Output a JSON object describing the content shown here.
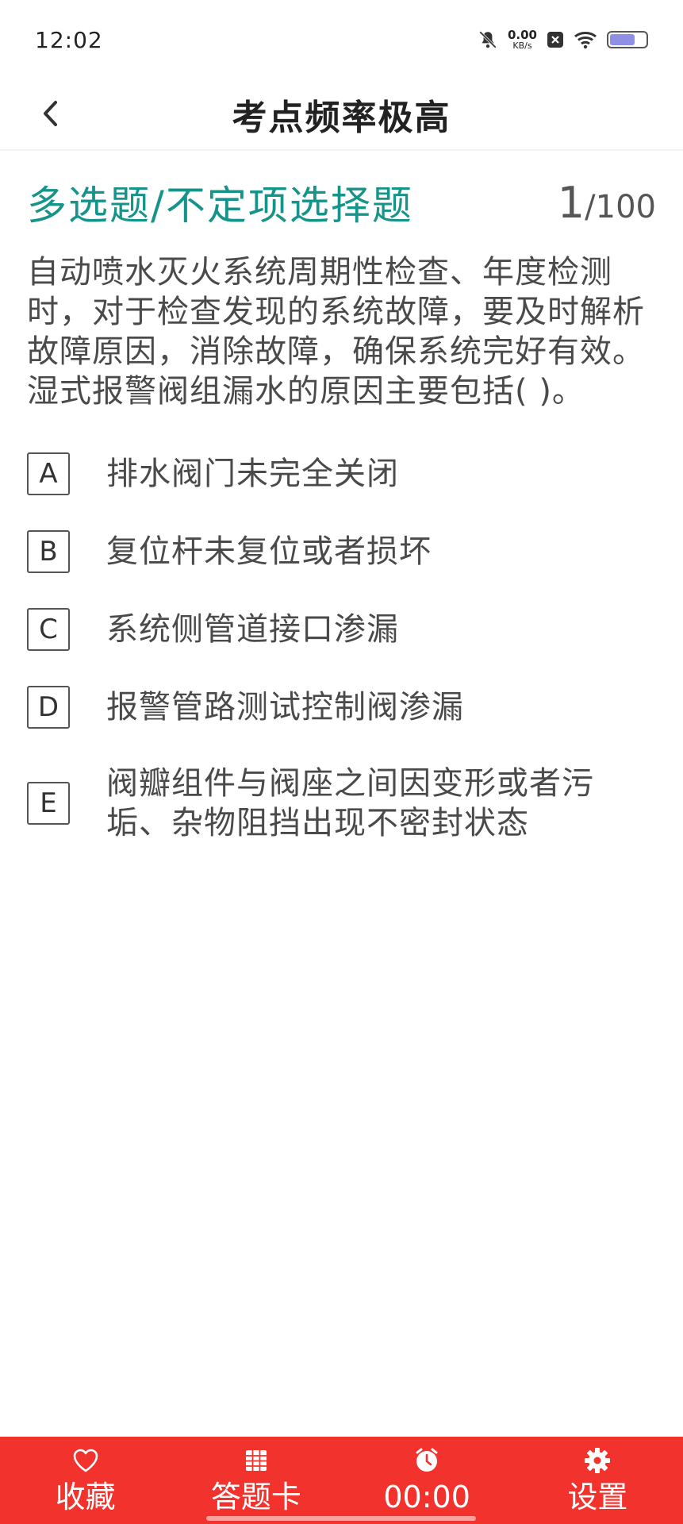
{
  "status_bar": {
    "time": "12:02",
    "net_speed_value": "0.00",
    "net_speed_unit": "KB/s",
    "icons": [
      "mute-bell-icon",
      "sim-x-icon",
      "wifi-icon",
      "battery-icon"
    ],
    "battery_level": 0.7
  },
  "header": {
    "title": "考点频率极高",
    "back_icon": "chevron-left-icon"
  },
  "question": {
    "type": "多选题/不定项选择题",
    "current": "1",
    "separator": "/",
    "total": "100",
    "stem": "自动喷水灭火系统周期性检查、年度检测时，对于检查发现的系统故障，要及时解析故障原因，消除故障，确保系统完好有效。湿式报警阀组漏水的原因主要包括( )。",
    "options": [
      {
        "key": "A",
        "text": "排水阀门未完全关闭"
      },
      {
        "key": "B",
        "text": "复位杆未复位或者损坏"
      },
      {
        "key": "C",
        "text": "系统侧管道接口渗漏"
      },
      {
        "key": "D",
        "text": "报警管路测试控制阀渗漏"
      },
      {
        "key": "E",
        "text": "阀瓣组件与阀座之间因变形或者污垢、杂物阻挡出现不密封状态"
      }
    ]
  },
  "bottom_bar": {
    "background": "#f2322d",
    "items": [
      {
        "label": "收藏",
        "icon": "heart-icon"
      },
      {
        "label": "答题卡",
        "icon": "grid-icon"
      },
      {
        "label": "00:00",
        "icon": "clock-icon"
      },
      {
        "label": "设置",
        "icon": "gear-icon"
      }
    ]
  },
  "colors": {
    "accent": "#16948a",
    "text": "#4a4a4a"
  }
}
